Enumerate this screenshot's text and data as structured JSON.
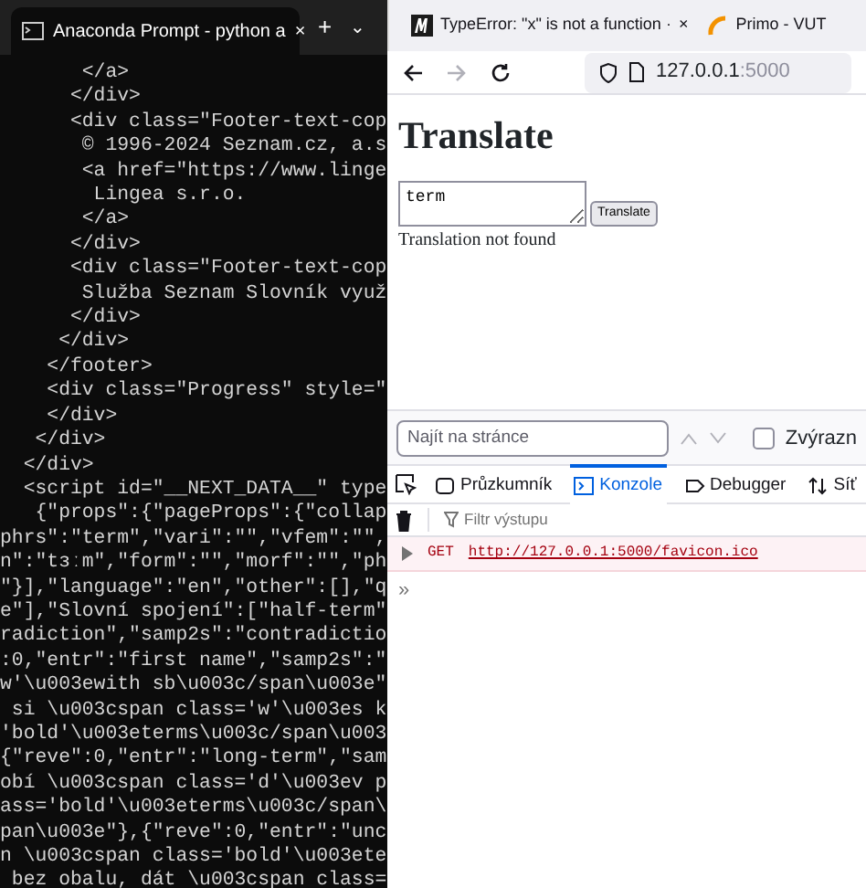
{
  "terminal": {
    "tab_title": "Anaconda Prompt - python a",
    "close": "×",
    "new_tab": "+",
    "dropdown": "⌄",
    "lines": [
      "       </a>",
      "      </div>",
      "      <div class=\"Footer-text-cop",
      "       © 1996-2024 Seznam.cz, a.s",
      "       <a href=\"https://www.linge",
      "        Lingea s.r.o.",
      "       </a>",
      "      </div>",
      "      <div class=\"Footer-text-cop",
      "       Služba Seznam Slovník využ",
      "      </div>",
      "     </div>",
      "    </footer>",
      "    <div class=\"Progress\" style=\"",
      "    </div>",
      "   </div>",
      "  </div>",
      "  <script id=\"__NEXT_DATA__\" type",
      "   {\"props\":{\"pageProps\":{\"collap",
      "phrs\":\"term\",\"vari\":\"\",\"vfem\":\"\",",
      "n\":\"tɜːm\",\"form\":\"\",\"morf\":\"\",\"ph",
      "\"}],\"language\":\"en\",\"other\":[],\"q",
      "e\"],\"Slovní spojení\":[\"half-term\"",
      "radiction\",\"samp2s\":\"contradictio",
      ":0,\"entr\":\"first name\",\"samp2s\":\"",
      "w'\\u003ewith sb\\u003c/span\\u003e\"",
      " si \\u003cspan class='w'\\u003es k",
      "'bold'\\u003eterms\\u003c/span\\u003",
      "{\"reve\":0,\"entr\":\"long-term\",\"sam",
      "obí \\u003cspan class='d'\\u003ev p",
      "ass='bold'\\u003eterms\\u003c/span\\",
      "pan\\u003e\"},{\"reve\":0,\"entr\":\"unc",
      "n \\u003cspan class='bold'\\u003ete",
      " bez obalu, dát \\u003cspan class="
    ]
  },
  "browser": {
    "tabs": [
      {
        "title": "TypeError: \"x\" is not a function ·",
        "close": "×",
        "selected": false,
        "kind": "mdn"
      },
      {
        "title": "Primo - VUT",
        "selected": false,
        "kind": "primo"
      }
    ],
    "address": {
      "host": "127.0.0.1",
      "port": ":5000"
    },
    "page": {
      "heading": "Translate",
      "textarea_value": "term",
      "button": "Translate",
      "message": "Translation not found"
    },
    "find_bar": {
      "placeholder": "Najít na stránce",
      "checkbox_label": "Zvýrazn",
      "checked": false
    },
    "devtools": {
      "tabs": [
        {
          "label": "Průzkumník",
          "kind": "inspector",
          "selected": false
        },
        {
          "label": "Konzole",
          "kind": "console",
          "selected": true
        },
        {
          "label": "Debugger",
          "kind": "debugger",
          "selected": false
        },
        {
          "label": "Síť",
          "kind": "network",
          "selected": false
        }
      ],
      "filter_placeholder": "Filtr výstupu",
      "messages": [
        {
          "kind": "error",
          "method": "GET",
          "url": "http://127.0.0.1:5000/favicon.ico"
        }
      ],
      "prompt": "»"
    }
  }
}
